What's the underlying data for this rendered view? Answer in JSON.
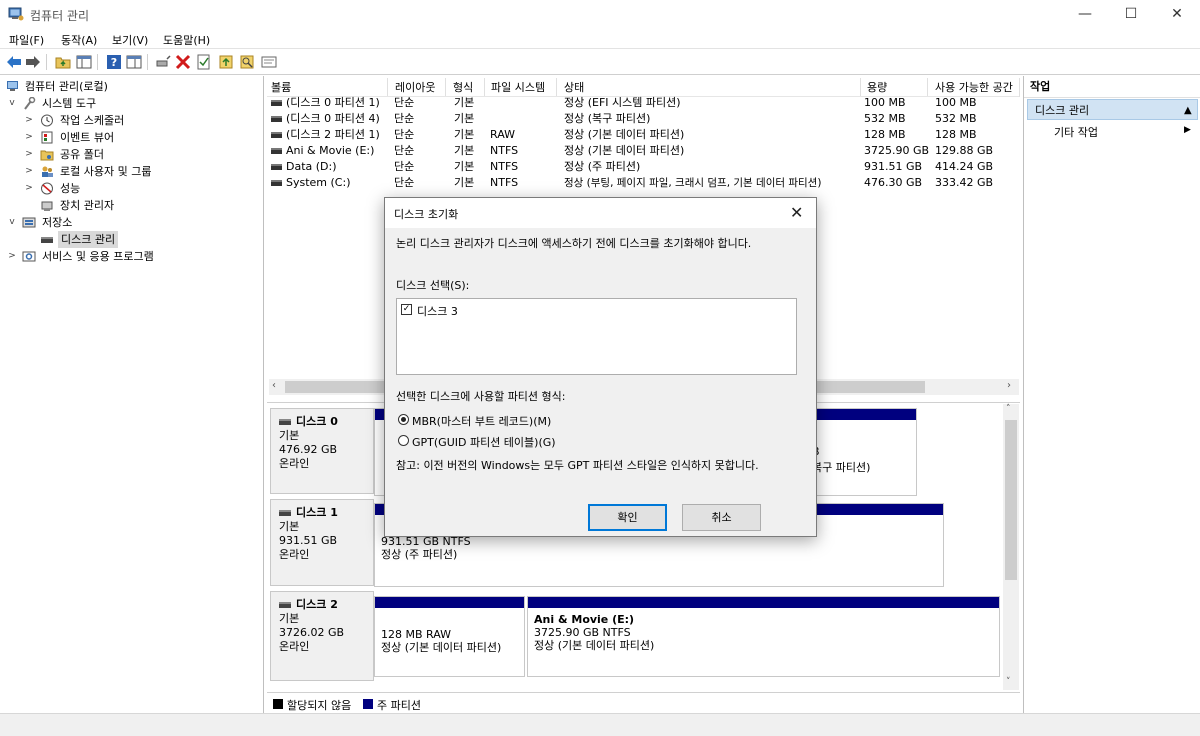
{
  "window": {
    "title": "컴퓨터 관리",
    "minimize": "—",
    "maximize": "☐",
    "close": "✕"
  },
  "menu": [
    "파일(F)",
    "동작(A)",
    "보기(V)",
    "도움말(H)"
  ],
  "toolbar": {
    "icons": [
      "back-arrow-icon",
      "forward-arrow-icon",
      "up-folder-icon",
      "show-hide-tree-icon",
      "help-icon",
      "console-view-icon",
      "connect-icon",
      "delete-icon",
      "properties-icon",
      "import-icon",
      "search-icon",
      "more-icon"
    ]
  },
  "tree": {
    "items": [
      {
        "label": "컴퓨터 관리(로컬)",
        "level": 0,
        "expander": ""
      },
      {
        "label": "시스템 도구",
        "level": 1,
        "expander": "v"
      },
      {
        "label": "작업 스케줄러",
        "level": 2,
        "expander": ">"
      },
      {
        "label": "이벤트 뷰어",
        "level": 2,
        "expander": ">"
      },
      {
        "label": "공유 폴더",
        "level": 2,
        "expander": ">"
      },
      {
        "label": "로컬 사용자 및 그룹",
        "level": 2,
        "expander": ">"
      },
      {
        "label": "성능",
        "level": 2,
        "expander": ">"
      },
      {
        "label": "장치 관리자",
        "level": 2,
        "expander": ""
      },
      {
        "label": "저장소",
        "level": 1,
        "expander": "v"
      },
      {
        "label": "디스크 관리",
        "level": 2,
        "expander": ""
      },
      {
        "label": "서비스 및 응용 프로그램",
        "level": 1,
        "expander": ">"
      }
    ]
  },
  "volumes": {
    "headers": [
      "볼륨",
      "레이아웃",
      "형식",
      "파일 시스템",
      "상태",
      "용량",
      "사용 가능한 공간"
    ],
    "rows": [
      [
        "(디스크 0 파티션 1)",
        "단순",
        "기본",
        "",
        "정상 (EFI 시스템 파티션)",
        "100 MB",
        "100 MB"
      ],
      [
        "(디스크 0 파티션 4)",
        "단순",
        "기본",
        "",
        "정상 (복구 파티션)",
        "532 MB",
        "532 MB"
      ],
      [
        "(디스크 2 파티션 1)",
        "단순",
        "기본",
        "RAW",
        "정상 (기본 데이터 파티션)",
        "128 MB",
        "128 MB"
      ],
      [
        "Ani & Movie (E:)",
        "단순",
        "기본",
        "NTFS",
        "정상 (기본 데이터 파티션)",
        "3725.90 GB",
        "129.88 GB"
      ],
      [
        "Data (D:)",
        "단순",
        "기본",
        "NTFS",
        "정상 (주 파티션)",
        "931.51 GB",
        "414.24 GB"
      ],
      [
        "System (C:)",
        "단순",
        "기본",
        "NTFS",
        "정상 (부팅, 페이지 파일, 크래시 덤프, 기본 데이터 파티션)",
        "476.30 GB",
        "333.42 GB"
      ]
    ]
  },
  "disks": [
    {
      "name": "디스크 0",
      "type": "기본",
      "size": "476.92 GB",
      "status": "온라인",
      "partial_text": [
        "B",
        "복구 파티션)"
      ]
    },
    {
      "name": "디스크 1",
      "type": "기본",
      "size": "931.51 GB",
      "status": "온라인",
      "partition": {
        "size": "931.51 GB NTFS",
        "status": "정상 (주 파티션)"
      }
    },
    {
      "name": "디스크 2",
      "type": "기본",
      "size": "3726.02 GB",
      "status": "온라인",
      "partitions": [
        {
          "title": "",
          "size": "128 MB RAW",
          "status": "정상 (기본 데이터 파티션)"
        },
        {
          "title": "Ani & Movie  (E:)",
          "size": "3725.90 GB NTFS",
          "status": "정상 (기본 데이터 파티션)"
        }
      ]
    }
  ],
  "legend": {
    "unallocated": "할당되지 않음",
    "primary": "주 파티션",
    "unallocated_color": "#000000",
    "primary_color": "#00007f"
  },
  "actions": {
    "header": "작업",
    "selected": "디스크 관리",
    "more": "기타 작업"
  },
  "dialog": {
    "title": "디스크 초기화",
    "message": "논리 디스크 관리자가 디스크에 액세스하기 전에 디스크를 초기화해야 합니다.",
    "select_label": "디스크 선택(S):",
    "disk_item": "디스크 3",
    "disk_checked": true,
    "style_label": "선택한 디스크에 사용할 파티션 형식:",
    "mbr_option": "MBR(마스터 부트 레코드)(M)",
    "gpt_option": "GPT(GUID 파티션 테이블)(G)",
    "selected_option": "MBR",
    "note": "참고: 이전 버전의 Windows는 모두 GPT 파티션 스타일은 인식하지 못합니다.",
    "ok": "확인",
    "cancel": "취소"
  }
}
